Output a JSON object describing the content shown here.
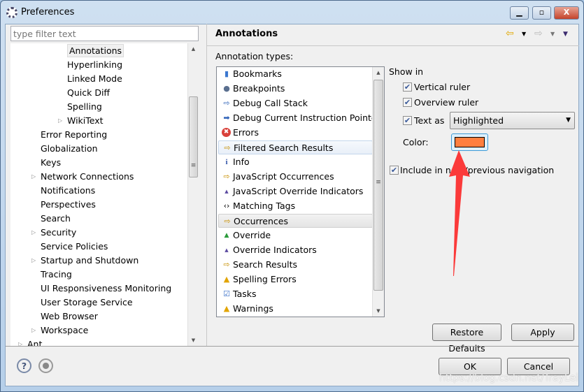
{
  "window": {
    "title": "Preferences",
    "icon": "eclipse-gear-icon"
  },
  "filter": {
    "placeholder": "type filter text"
  },
  "tree": {
    "items": [
      {
        "label": "Annotations",
        "level": 3,
        "selected": true
      },
      {
        "label": "Hyperlinking",
        "level": 3
      },
      {
        "label": "Linked Mode",
        "level": 3
      },
      {
        "label": "Quick Diff",
        "level": 3
      },
      {
        "label": "Spelling",
        "level": 3
      },
      {
        "label": "WikiText",
        "level": 3,
        "expandable": true
      },
      {
        "label": "Error Reporting",
        "level": 2
      },
      {
        "label": "Globalization",
        "level": 2
      },
      {
        "label": "Keys",
        "level": 2
      },
      {
        "label": "Network Connections",
        "level": 2,
        "expandable": true
      },
      {
        "label": "Notifications",
        "level": 2
      },
      {
        "label": "Perspectives",
        "level": 2
      },
      {
        "label": "Search",
        "level": 2
      },
      {
        "label": "Security",
        "level": 2,
        "expandable": true
      },
      {
        "label": "Service Policies",
        "level": 2
      },
      {
        "label": "Startup and Shutdown",
        "level": 2,
        "expandable": true
      },
      {
        "label": "Tracing",
        "level": 2
      },
      {
        "label": "UI Responsiveness Monitoring",
        "level": 2
      },
      {
        "label": "User Storage Service",
        "level": 2
      },
      {
        "label": "Web Browser",
        "level": 2
      },
      {
        "label": "Workspace",
        "level": 2,
        "expandable": true
      },
      {
        "label": "Ant",
        "level": 1,
        "expandable": true
      }
    ]
  },
  "page": {
    "title": "Annotations",
    "annotation_types_label": "Annotation types:",
    "annotation_types": [
      {
        "label": "Bookmarks",
        "icon": "bookmark-icon"
      },
      {
        "label": "Breakpoints",
        "icon": "breakpoint-icon"
      },
      {
        "label": "Debug Call Stack",
        "icon": "hollow-arrow-icon"
      },
      {
        "label": "Debug Current Instruction Pointer",
        "icon": "filled-arrow-icon"
      },
      {
        "label": "Errors",
        "icon": "error-icon"
      },
      {
        "label": "Filtered Search Results",
        "icon": "search-result-arrow-icon",
        "state": "hover"
      },
      {
        "label": "Info",
        "icon": "info-icon"
      },
      {
        "label": "JavaScript Occurrences",
        "icon": "occurrence-arrow-icon"
      },
      {
        "label": "JavaScript Override Indicators",
        "icon": "override-indicator-icon"
      },
      {
        "label": "Matching Tags",
        "icon": "angle-brackets-icon"
      },
      {
        "label": "Occurrences",
        "icon": "occurrence-arrow-icon",
        "state": "selected"
      },
      {
        "label": "Override",
        "icon": "override-triangle-icon"
      },
      {
        "label": "Override Indicators",
        "icon": "override-indicator-icon"
      },
      {
        "label": "Search Results",
        "icon": "search-result-arrow-icon"
      },
      {
        "label": "Spelling Errors",
        "icon": "warning-icon"
      },
      {
        "label": "Tasks",
        "icon": "task-icon"
      },
      {
        "label": "Warnings",
        "icon": "warning-icon"
      }
    ],
    "show_in": "Show in",
    "vertical_ruler": {
      "label": "Vertical ruler",
      "checked": true
    },
    "overview_ruler": {
      "label": "Overview ruler",
      "checked": true
    },
    "text_as": {
      "label": "Text as",
      "checked": true,
      "value": "Highlighted"
    },
    "color_label": "Color:",
    "color": "#ff7f3f",
    "include_nav": {
      "label": "Include in next/previous navigation",
      "checked": true
    },
    "restore_defaults": "Restore Defaults",
    "apply": "Apply"
  },
  "footer": {
    "ok": "OK",
    "cancel": "Cancel"
  },
  "watermark": "https://blog.csdn.net/TrayLei"
}
